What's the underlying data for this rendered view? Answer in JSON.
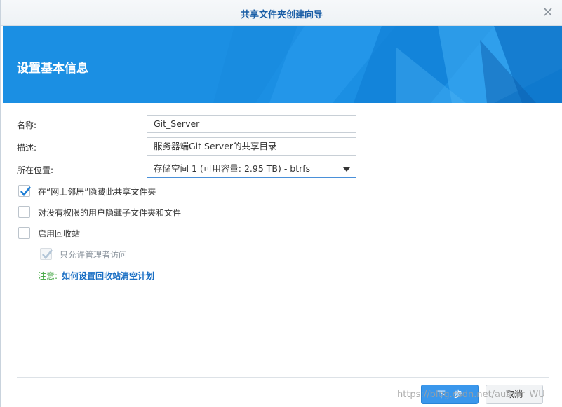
{
  "window": {
    "title": "共享文件夹创建向导"
  },
  "banner": {
    "heading": "设置基本信息"
  },
  "form": {
    "name_label": "名称:",
    "name_value": "Git_Server",
    "desc_label": "描述:",
    "desc_value": "服务器端Git Server的共享目录",
    "location_label": "所在位置:",
    "location_value": "存储空间 1 (可用容量:  2.95 TB) - btrfs"
  },
  "options": [
    {
      "label": "在“网上邻居”隐藏此共享文件夹",
      "checked": true,
      "disabled": false
    },
    {
      "label": "对没有权限的用户隐藏子文件夹和文件",
      "checked": false,
      "disabled": false
    },
    {
      "label": "启用回收站",
      "checked": false,
      "disabled": false
    },
    {
      "label": "只允许管理者访问",
      "checked": true,
      "disabled": true
    }
  ],
  "note": {
    "prefix": "注意:",
    "link": "如何设置回收站清空计划"
  },
  "buttons": {
    "next": "下一步",
    "cancel": "取消"
  },
  "watermark": "https://blog.csdn.net/author_WU",
  "colors": {
    "accent": "#3a97ec",
    "banner": "#1b8fe3",
    "link": "#1a6fc4",
    "note": "#3aa33a"
  }
}
